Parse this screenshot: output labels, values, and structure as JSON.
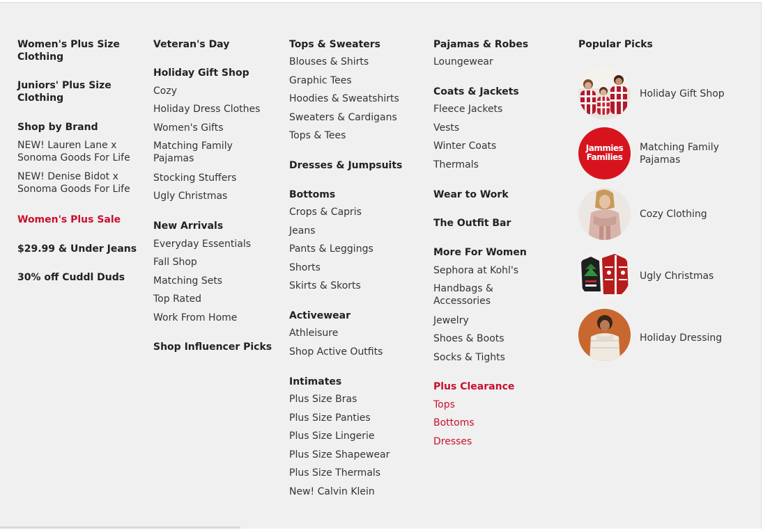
{
  "col1": {
    "womens_plus_l1": "Women's Plus Size",
    "womens_plus_l2": "Clothing",
    "juniors_plus_l1": "Juniors' Plus Size",
    "juniors_plus_l2": "Clothing",
    "shop_by_brand": "Shop by Brand",
    "lauren_l1": "NEW! Lauren Lane x",
    "lauren_l2": "Sonoma Goods For Life",
    "denise_l1": "NEW! Denise Bidot x",
    "denise_l2": "Sonoma Goods For Life",
    "plus_sale": "Women's Plus Sale",
    "under_jeans": "$29.99 & Under Jeans",
    "cuddl": "30% off Cuddl Duds"
  },
  "col2": {
    "veterans": "Veteran's Day",
    "gift_shop": "Holiday Gift Shop",
    "cozy": "Cozy",
    "holiday_dress": "Holiday Dress Clothes",
    "womens_gifts": "Women's Gifts",
    "matching_l1": "Matching Family",
    "matching_l2": "Pajamas",
    "stocking": "Stocking Stuffers",
    "ugly": "Ugly Christmas",
    "new_arrivals": "New Arrivals",
    "everyday": "Everyday Essentials",
    "fall": "Fall Shop",
    "matching_sets": "Matching Sets",
    "top_rated": "Top Rated",
    "wfh": "Work From Home",
    "influencer": "Shop Influencer Picks"
  },
  "col3": {
    "tops_sweaters": "Tops & Sweaters",
    "blouses": "Blouses & Shirts",
    "graphic": "Graphic Tees",
    "hoodies": "Hoodies & Sweatshirts",
    "sweaters": "Sweaters & Cardigans",
    "tops_tees": "Tops & Tees",
    "dresses": "Dresses & Jumpsuits",
    "bottoms": "Bottoms",
    "crops": "Crops & Capris",
    "jeans": "Jeans",
    "pants": "Pants & Leggings",
    "shorts": "Shorts",
    "skirts": "Skirts & Skorts",
    "activewear": "Activewear",
    "athleisure": "Athleisure",
    "active_outfits": "Shop Active Outfits",
    "intimates": "Intimates",
    "bras": "Plus Size Bras",
    "panties": "Plus Size Panties",
    "lingerie": "Plus Size Lingerie",
    "shapewear": "Plus Size Shapewear",
    "thermals": "Plus Size Thermals",
    "calvin": "New! Calvin Klein"
  },
  "col4": {
    "pajamas": "Pajamas & Robes",
    "loungewear": "Loungewear",
    "coats": "Coats & Jackets",
    "fleece": "Fleece Jackets",
    "vests": "Vests",
    "winter": "Winter Coats",
    "thermals": "Thermals",
    "work": "Wear to Work",
    "outfit_bar": "The Outfit Bar",
    "more_women": "More For Women",
    "sephora": "Sephora at Kohl's",
    "handbags_l1": "Handbags &",
    "handbags_l2": "Accessories",
    "jewelry": "Jewelry",
    "shoes": "Shoes & Boots",
    "socks": "Socks & Tights",
    "plus_clearance": "Plus Clearance",
    "tops": "Tops",
    "bottoms": "Bottoms",
    "dresses": "Dresses"
  },
  "popular": {
    "heading": "Popular Picks",
    "gift_shop": "Holiday Gift Shop",
    "matching_l1": "Matching Family",
    "matching_l2": "Pajamas",
    "jammies_logo_l1": "Jammies",
    "jammies_logo_l2": "Families",
    "cozy": "Cozy Clothing",
    "ugly": "Ugly Christmas",
    "dressing": "Holiday Dressing"
  },
  "colors": {
    "panel_bg": "#f0f0f0",
    "text": "#333333",
    "accent_red": "#c8102e"
  },
  "icons": {
    "gift_shop": "family-pajamas-photo",
    "matching": "jammies-families-logo",
    "cozy": "cozy-clothing-photo",
    "ugly": "ugly-sweater-photo",
    "dressing": "holiday-dressing-photo"
  }
}
